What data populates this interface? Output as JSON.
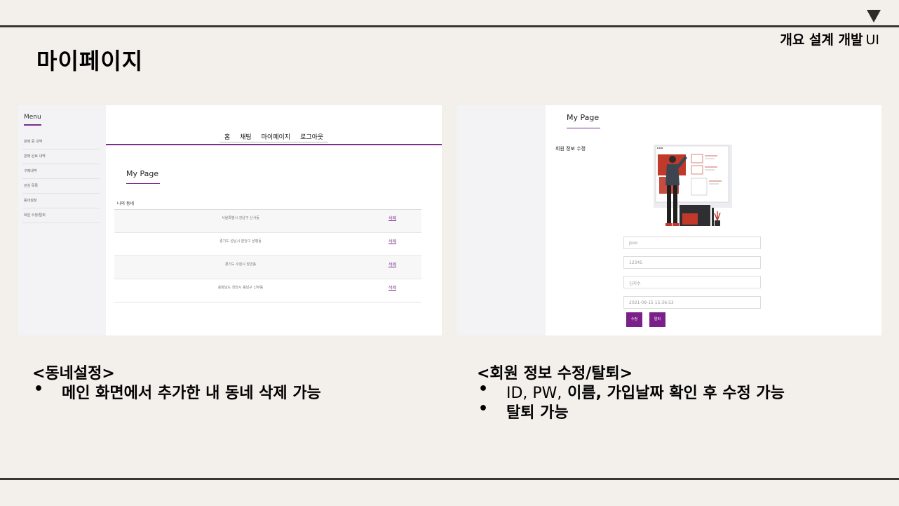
{
  "slide": {
    "title": "마이페이지",
    "section_tag": "개요 설계 개발",
    "section_tag_suffix": "UI"
  },
  "left_screen": {
    "sidebar_title": "Menu",
    "sidebar_items": [
      "판매 중 내역",
      "판매 완료 내역",
      "구매내역",
      "관심 목록",
      "동네설정",
      "회원 수정/탈퇴"
    ],
    "nav_items": [
      "홈",
      "채팅",
      "마이페이지",
      "로그아웃"
    ],
    "page_title": "My Page",
    "table_header": "나의 동네",
    "rows": [
      {
        "address": "서울특별시 강남구 신사동",
        "action": "삭제"
      },
      {
        "address": "경기도 성남시 분당구 삼평동",
        "action": "삭제"
      },
      {
        "address": "경기도 수원시 장안동",
        "action": "삭제"
      },
      {
        "address": "충청남도 천안시 동남구 신부동",
        "action": "삭제"
      }
    ]
  },
  "right_screen": {
    "page_title": "My Page",
    "section_label": "회원 정보 수정",
    "fields": {
      "id": "jsoo",
      "pw": "12345",
      "name": "김지수",
      "join_date": "2021-09-15 15:36:53"
    },
    "buttons": {
      "edit": "수정",
      "withdraw": "탈퇴"
    }
  },
  "captions": {
    "left_heading": "<동네설정>",
    "left_bullets": [
      "메인 화면에서 추가한 내 동네 삭제 가능"
    ],
    "right_heading": "<회원 정보 수정/탈퇴>",
    "right_bullet1_light": "ID, PW,",
    "right_bullet1_bold": " 이름, 가입날짜 확인 후 수정 가능",
    "right_bullet2": "탈퇴 가능",
    "bullet_symbol": "•"
  },
  "colors": {
    "accent_purple": "#7b2d8e",
    "background": "#f3f0eb",
    "rule": "#3a3532"
  }
}
